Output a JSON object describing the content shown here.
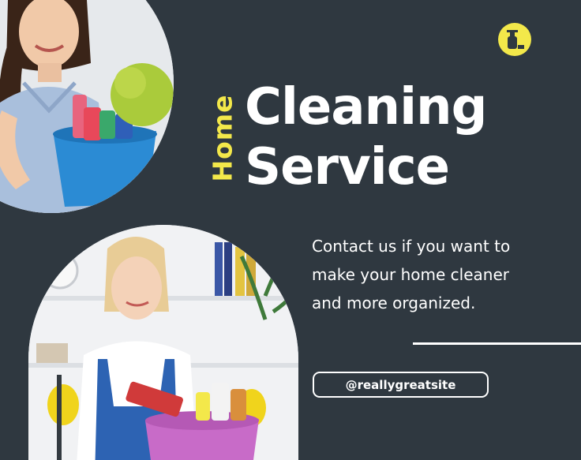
{
  "badge": {
    "icon": "spray-bottle-icon",
    "color": "#f3e84a"
  },
  "title": {
    "vertical": "Home",
    "line1": "Cleaning",
    "line2": "Service"
  },
  "description": "Contact us if you want to make your home cleaner and more organized.",
  "button": {
    "label": "@reallygreatsite"
  },
  "photos": {
    "top": "woman-holding-cleaning-bucket-photo",
    "bottom": "woman-with-pink-cleaning-bucket-photo"
  },
  "colors": {
    "background": "#2f3840",
    "accent": "#f3e84a",
    "text": "#ffffff"
  }
}
